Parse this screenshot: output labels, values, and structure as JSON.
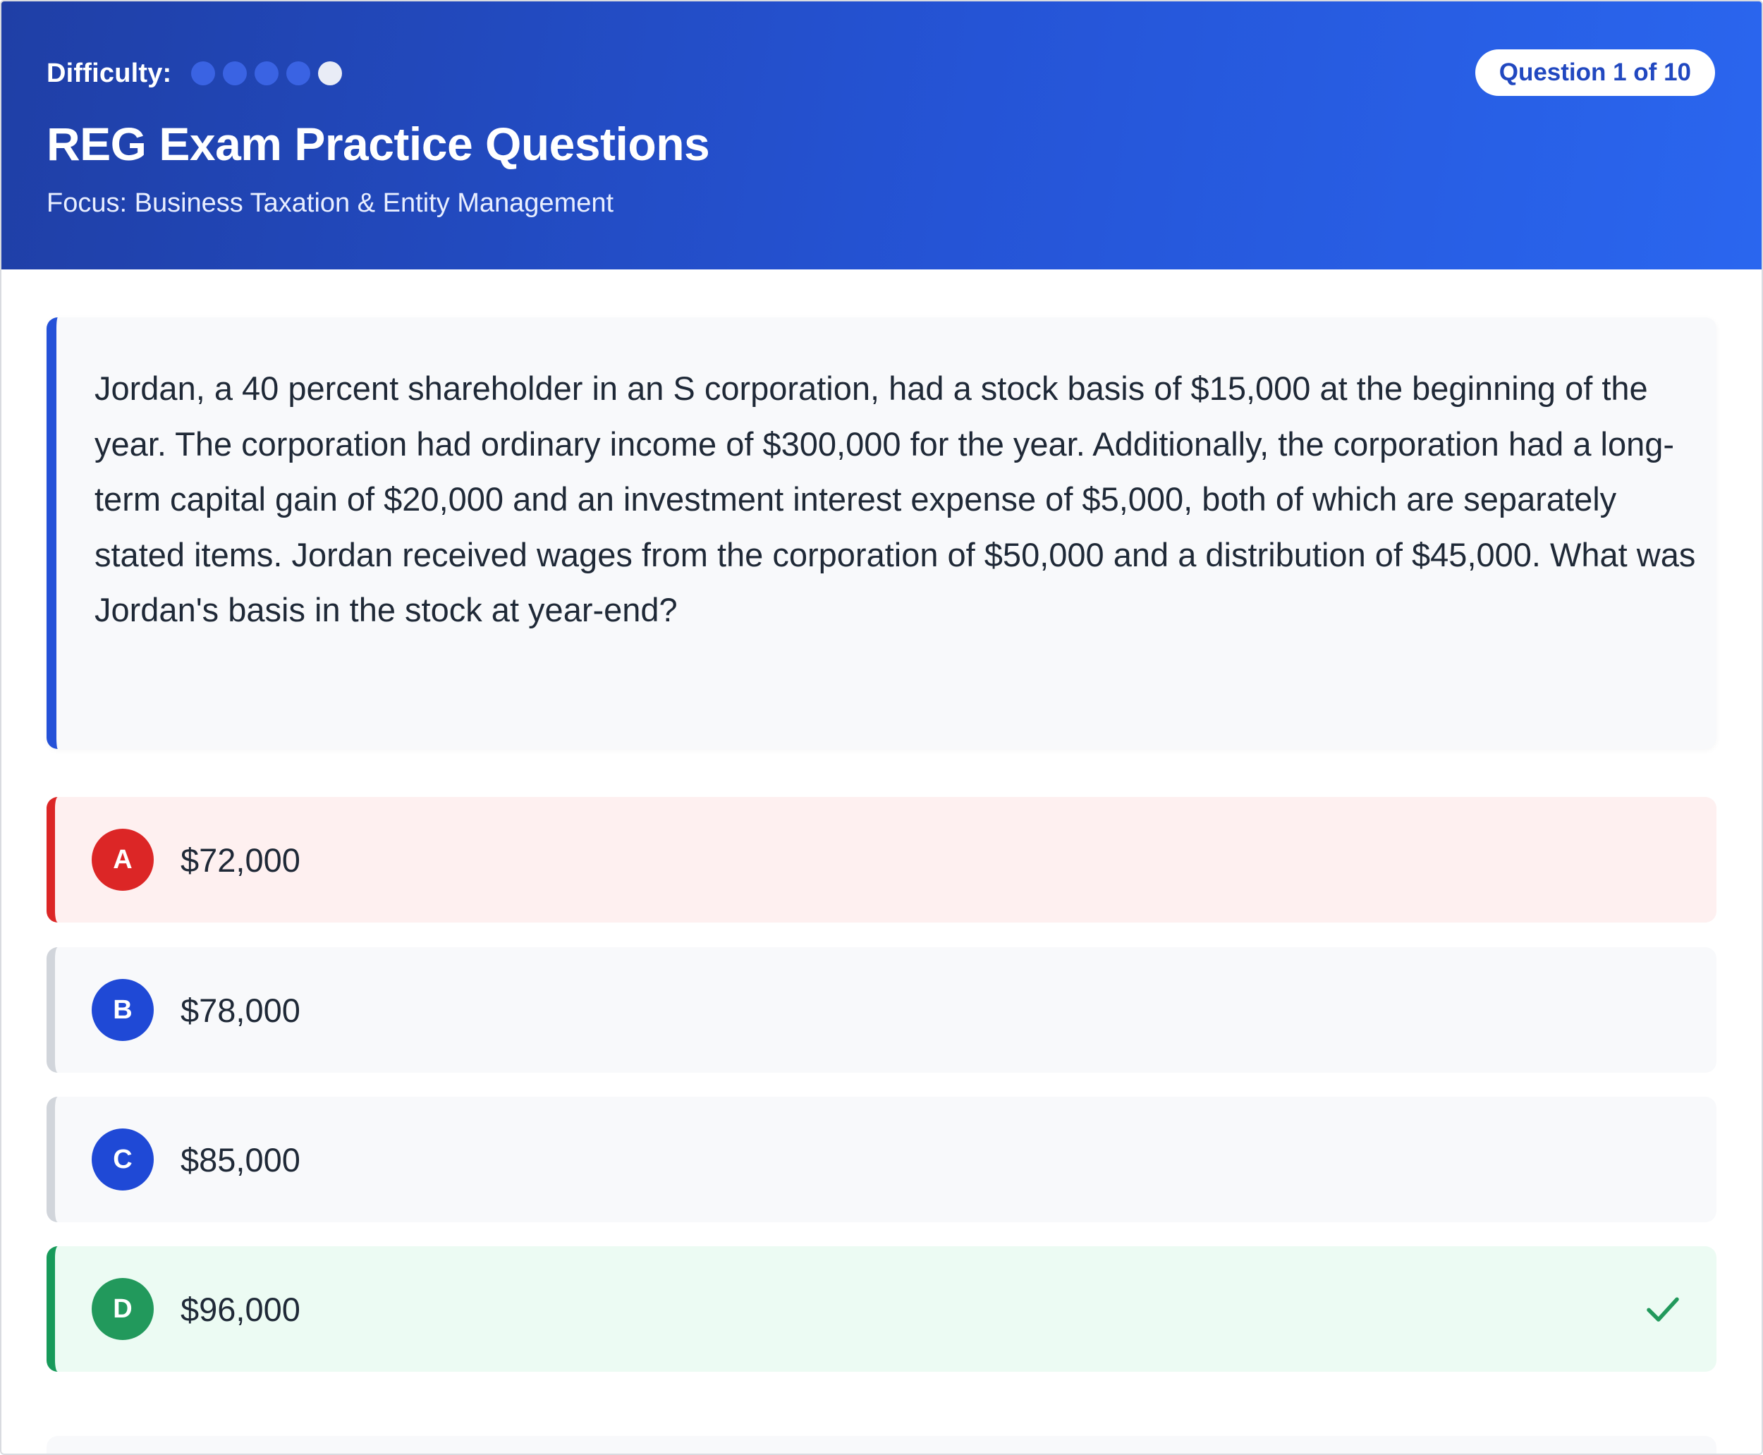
{
  "header": {
    "difficulty_label": "Difficulty:",
    "difficulty": {
      "level": 4,
      "max": 5
    },
    "title": "REG Exam Practice Questions",
    "subtitle": "Focus: Business Taxation & Entity Management",
    "question_counter": "Question 1 of 10"
  },
  "question": {
    "text": "Jordan, a 40 percent shareholder in an S corporation, had a stock basis of $15,000 at the beginning of the year. The corporation had ordinary income of $300,000 for the year. Additionally, the corporation had a long-term capital gain of $20,000 and an investment interest expense of $5,000, both of which are separately stated items. Jordan received wages from the corporation of $50,000 and a distribution of $45,000. What was Jordan's basis in the stock at year-end?"
  },
  "options": [
    {
      "letter": "A",
      "text": "$72,000",
      "state": "incorrect"
    },
    {
      "letter": "B",
      "text": "$78,000",
      "state": "neutral"
    },
    {
      "letter": "C",
      "text": "$85,000",
      "state": "neutral"
    },
    {
      "letter": "D",
      "text": "$96,000",
      "state": "correct"
    }
  ],
  "colors": {
    "header_start": "#1f3fa6",
    "header_end": "#2a66ef",
    "accent_blue": "#2451d8",
    "incorrect": "#dc2626",
    "incorrect_bg": "#fef0f0",
    "correct": "#22995c",
    "correct_bg": "#ecfbf3"
  },
  "icons": {
    "correct_mark": "check-icon"
  }
}
